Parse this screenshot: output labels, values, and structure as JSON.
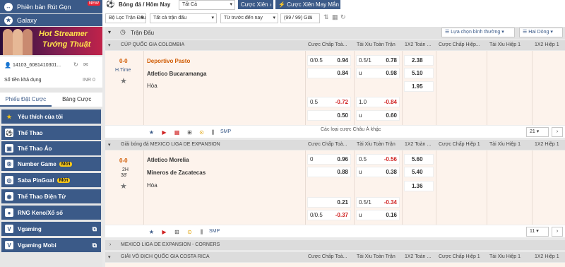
{
  "sidebar": {
    "top1": "Phiên bản Rút Gọn",
    "top1_badge": "NEW",
    "top2": "Galaxy",
    "banner_line1": "Hot Streamer",
    "banner_line2": "Tướng Thuật",
    "account_id": "14103_6081410301...",
    "balance_label": "Số tiền khả dụng",
    "balance_value": "INR 0",
    "tab_bets": "Phiếu Đặt Cược",
    "tab_betlist": "Bảng Cược",
    "menu": [
      {
        "label": "Yêu thích của tôi",
        "icon": "star-icon",
        "badge": ""
      },
      {
        "label": "Thể Thao",
        "icon": "soccer-ball-icon",
        "badge": ""
      },
      {
        "label": "Thể Thao Ảo",
        "icon": "virtual-sports-icon",
        "badge": ""
      },
      {
        "label": "Number Game",
        "icon": "number-game-icon",
        "badge": "Mới"
      },
      {
        "label": "Saba PinGoal",
        "icon": "pingoal-icon",
        "badge": "Mới"
      },
      {
        "label": "Thể Thao Điện Tử",
        "icon": "esports-icon",
        "badge": ""
      },
      {
        "label": "RNG Keno/Xổ số",
        "icon": "keno-icon",
        "badge": ""
      },
      {
        "label": "Vgaming",
        "icon": "vgaming-icon",
        "badge": ""
      },
      {
        "label": "Vgaming Mobi",
        "icon": "vgaming-mobile-icon",
        "badge": ""
      }
    ]
  },
  "topbar": {
    "breadcrumb": "Bóng đá / Hôm Nay",
    "sport_select": "Tất Cả",
    "parlay_btn": "Cược Xiên",
    "lucky_btn": "Cược Xiên May Mắn",
    "filter_league": "Bộ Lọc Trận Đấu",
    "filter_all": "Tất cả trận đấu",
    "filter_time": "Từ trước đến nay",
    "count": "(99 / 99) Giải"
  },
  "section": {
    "title": "Trận Đấu",
    "odds_view": "Lựa chọn bình thường",
    "lines": "Hai Dòng"
  },
  "columns": {
    "hdp": "Cược Chấp Toà...",
    "ou": "Tài Xỉu Toàn Trận",
    "x12": "1X2 Toàn ...",
    "hdp_h1": "Cược Chấp Hiệp...",
    "ou_h1": "Tài Xỉu Hiệp 1",
    "x12_h1": "1X2 Hiệp 1"
  },
  "columns2": {
    "hdp": "Cược Chấp Toà...",
    "ou": "Tài Xỉu Toàn Trận",
    "x12": "1X2 Toàn ...",
    "hdp_h1": "Cược Chấp Hiệp 1",
    "ou_h1": "Tài Xỉu Hiệp 1",
    "x12_h1": "1X2 Hiệp 1"
  },
  "league1": {
    "name": "CÚP QUỐC GIA COLOMBIA",
    "score": "0-0",
    "status": "H.Time",
    "home": "Deportivo Pasto",
    "away": "Atletico Bucaramanga",
    "draw": "Hòa",
    "r1": {
      "hdp_line": "0/0.5",
      "hdp_home": "0.94",
      "ou_line": "0.5/1",
      "ou_over": "0.78",
      "x1": "2.38",
      "hdp_away": "0.84",
      "ou_u": "u",
      "ou_under": "0.98",
      "x2": "5.10",
      "xd": "1.95"
    },
    "r2": {
      "hdp_line": "0.5",
      "hdp_home": "-0.72",
      "ou_line": "1.0",
      "ou_over": "-0.84",
      "hdp_away": "0.50",
      "ou_u": "u",
      "ou_under": "0.60"
    },
    "more": "Các loại cược Châu Á khác",
    "count": "21"
  },
  "league2": {
    "name": "Giải bóng đá MEXICO LIGA DE EXPANSION",
    "score": "0-0",
    "status1": "2H",
    "status2": "38'",
    "home": "Atletico Morelia",
    "away": "Mineros de Zacatecas",
    "draw": "Hòa",
    "r1": {
      "hdp_line": "0",
      "hdp_home": "0.96",
      "ou_line": "0.5",
      "ou_over": "-0.56",
      "x1": "5.60",
      "hdp_away": "0.88",
      "ou_u": "u",
      "ou_under": "0.38",
      "x2": "5.40",
      "xd": "1.36"
    },
    "r2": {
      "hdp_home": "0.21",
      "ou_line": "0.5/1",
      "ou_over": "-0.34",
      "hdp_line": "0/0.5",
      "hdp_away": "-0.37",
      "ou_u": "u",
      "ou_under": "0.16"
    },
    "count": "11"
  },
  "league3": {
    "name": "MEXICO LIGA DE EXPANSION - CORNERS"
  },
  "league4": {
    "name": "GIẢI VÔ ĐỊCH QUỐC GIA COSTA RICA"
  },
  "foot_tag": "SMP"
}
